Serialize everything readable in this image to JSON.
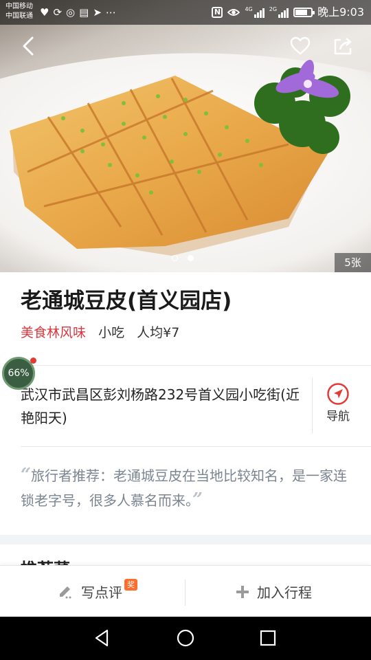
{
  "status_bar": {
    "carrier_1": "中国移动",
    "carrier_2": "中国联通",
    "left_icons": [
      "heart-monitor-icon",
      "sync-icon",
      "app-icon",
      "message-icon",
      "telegram-icon",
      "more-icon"
    ],
    "signal_1_label": "4G",
    "signal_2_label": "2G",
    "battery_level": 0.7,
    "time": "晚上9:03"
  },
  "hero": {
    "back_icon": "back-arrow-icon",
    "favorite_icon": "heart-outline-icon",
    "share_icon": "share-icon",
    "carousel_dots": 2,
    "active_dot": 1,
    "photo_count": "5张"
  },
  "restaurant": {
    "name": "老通城豆皮(首义园店)",
    "tag": "美食林风味",
    "category": "小吃",
    "avg_price": "人均¥7",
    "address": "武汉市武昌区彭刘杨路232号首义园小吃街(近艳阳天)",
    "navigate_label": "导航",
    "recommendation": "旅行者推荐：老通城豆皮在当地比较知名，是一家连锁老字号，很多人慕名而来。"
  },
  "overlay": {
    "progress": "66%"
  },
  "next_section": {
    "heading": "推荐菜"
  },
  "action_bar": {
    "review_label": "写点评",
    "reward_badge": "奖",
    "add_trip_label": "加入行程"
  },
  "colors": {
    "accent_red": "#d9363e",
    "navigate_red": "#e53935",
    "quote_text": "#7b8591",
    "reward_orange": "#ff6d2d"
  }
}
